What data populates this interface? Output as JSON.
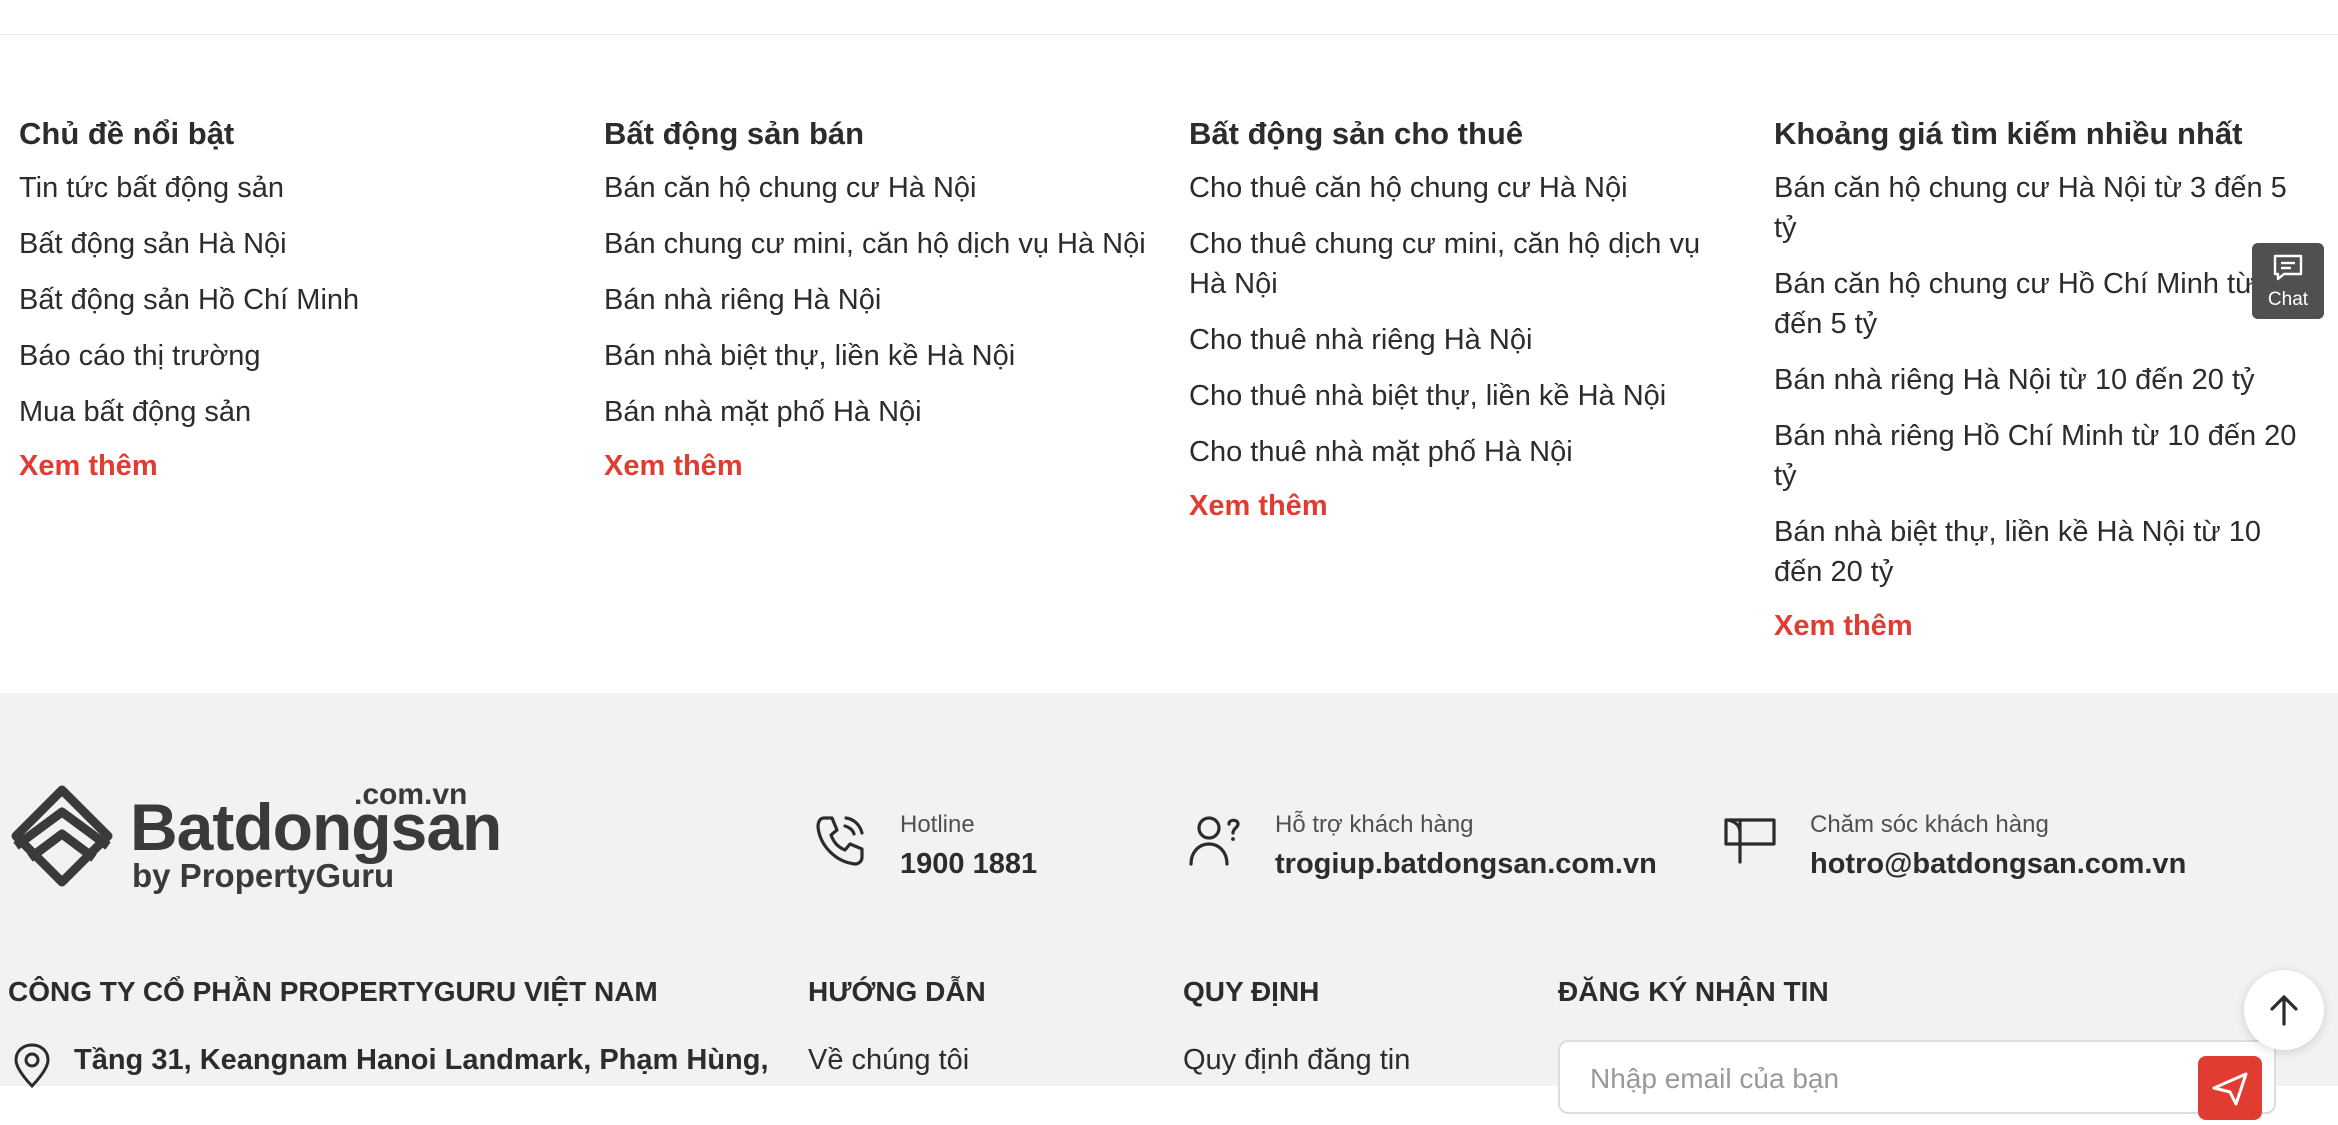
{
  "columns": [
    {
      "heading": "Chủ đề nổi bật",
      "items": [
        "Tin tức bất động sản",
        "Bất động sản Hà Nội",
        "Bất động sản Hồ Chí Minh",
        "Báo cáo thị trường",
        "Mua bất động sản"
      ],
      "more": "Xem thêm"
    },
    {
      "heading": "Bất động sản bán",
      "items": [
        "Bán căn hộ chung cư Hà Nội",
        "Bán chung cư mini, căn hộ dịch vụ Hà Nội",
        "Bán nhà riêng Hà Nội",
        "Bán nhà biệt thự, liền kề Hà Nội",
        "Bán nhà mặt phố Hà Nội"
      ],
      "more": "Xem thêm"
    },
    {
      "heading": "Bất động sản cho thuê",
      "items": [
        "Cho thuê căn hộ chung cư Hà Nội",
        "Cho thuê chung cư mini, căn hộ dịch vụ Hà Nội",
        "Cho thuê nhà riêng Hà Nội",
        "Cho thuê nhà biệt thự, liền kề Hà Nội",
        "Cho thuê nhà mặt phố Hà Nội"
      ],
      "more": "Xem thêm"
    },
    {
      "heading": "Khoảng giá tìm kiếm nhiều nhất",
      "items": [
        "Bán căn hộ chung cư Hà Nội từ 3 đến 5 tỷ",
        "Bán căn hộ chung cư Hồ Chí Minh từ 3 đến 5 tỷ",
        "Bán nhà riêng Hà Nội từ 10 đến 20 tỷ",
        "Bán nhà riêng Hồ Chí Minh từ 10 đến 20 tỷ",
        "Bán nhà biệt thự, liền kề Hà Nội từ 10 đến 20 tỷ"
      ],
      "more": "Xem thêm"
    }
  ],
  "logo": {
    "domain": ".com.vn",
    "name": "Batdongsan",
    "byline": "by PropertyGuru"
  },
  "contacts": {
    "hotline": {
      "label": "Hotline",
      "value": "1900 1881",
      "icon": "phone-icon"
    },
    "support": {
      "label": "Hỗ trợ khách hàng",
      "value": "trogiup.batdongsan.com.vn",
      "icon": "user-question-icon"
    },
    "care": {
      "label": "Chăm sóc khách hàng",
      "value": "hotro@batdongsan.com.vn",
      "icon": "mailbox-icon"
    }
  },
  "footer": {
    "company": "CÔNG TY CỔ PHẦN PROPERTYGURU VIỆT NAM",
    "address": "Tầng 31, Keangnam Hanoi Landmark, Phạm Hùng,",
    "guide_heading": "HƯỚNG DẪN",
    "guide_first": "Về chúng tôi",
    "rules_heading": "QUY ĐỊNH",
    "rules_first": "Quy định đăng tin",
    "newsletter_heading": "ĐĂNG KÝ NHẬN TIN",
    "newsletter_placeholder": "Nhập email của bạn"
  },
  "chat": {
    "label": "Chat"
  },
  "colors": {
    "accent": "#e03c31",
    "footer_bg": "#f2f2f2",
    "text": "#2c2c2c"
  }
}
